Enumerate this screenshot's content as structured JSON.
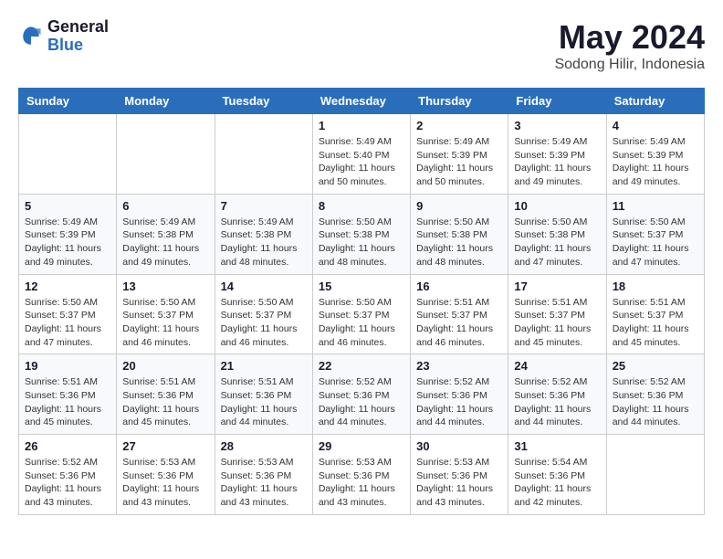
{
  "header": {
    "logo": {
      "general": "General",
      "blue": "Blue"
    },
    "title": "May 2024",
    "location": "Sodong Hilir, Indonesia"
  },
  "days_of_week": [
    "Sunday",
    "Monday",
    "Tuesday",
    "Wednesday",
    "Thursday",
    "Friday",
    "Saturday"
  ],
  "weeks": [
    [
      {
        "num": "",
        "sunrise": "",
        "sunset": "",
        "daylight": ""
      },
      {
        "num": "",
        "sunrise": "",
        "sunset": "",
        "daylight": ""
      },
      {
        "num": "",
        "sunrise": "",
        "sunset": "",
        "daylight": ""
      },
      {
        "num": "1",
        "sunrise": "Sunrise: 5:49 AM",
        "sunset": "Sunset: 5:40 PM",
        "daylight": "Daylight: 11 hours and 50 minutes."
      },
      {
        "num": "2",
        "sunrise": "Sunrise: 5:49 AM",
        "sunset": "Sunset: 5:39 PM",
        "daylight": "Daylight: 11 hours and 50 minutes."
      },
      {
        "num": "3",
        "sunrise": "Sunrise: 5:49 AM",
        "sunset": "Sunset: 5:39 PM",
        "daylight": "Daylight: 11 hours and 49 minutes."
      },
      {
        "num": "4",
        "sunrise": "Sunrise: 5:49 AM",
        "sunset": "Sunset: 5:39 PM",
        "daylight": "Daylight: 11 hours and 49 minutes."
      }
    ],
    [
      {
        "num": "5",
        "sunrise": "Sunrise: 5:49 AM",
        "sunset": "Sunset: 5:39 PM",
        "daylight": "Daylight: 11 hours and 49 minutes."
      },
      {
        "num": "6",
        "sunrise": "Sunrise: 5:49 AM",
        "sunset": "Sunset: 5:38 PM",
        "daylight": "Daylight: 11 hours and 49 minutes."
      },
      {
        "num": "7",
        "sunrise": "Sunrise: 5:49 AM",
        "sunset": "Sunset: 5:38 PM",
        "daylight": "Daylight: 11 hours and 48 minutes."
      },
      {
        "num": "8",
        "sunrise": "Sunrise: 5:50 AM",
        "sunset": "Sunset: 5:38 PM",
        "daylight": "Daylight: 11 hours and 48 minutes."
      },
      {
        "num": "9",
        "sunrise": "Sunrise: 5:50 AM",
        "sunset": "Sunset: 5:38 PM",
        "daylight": "Daylight: 11 hours and 48 minutes."
      },
      {
        "num": "10",
        "sunrise": "Sunrise: 5:50 AM",
        "sunset": "Sunset: 5:38 PM",
        "daylight": "Daylight: 11 hours and 47 minutes."
      },
      {
        "num": "11",
        "sunrise": "Sunrise: 5:50 AM",
        "sunset": "Sunset: 5:37 PM",
        "daylight": "Daylight: 11 hours and 47 minutes."
      }
    ],
    [
      {
        "num": "12",
        "sunrise": "Sunrise: 5:50 AM",
        "sunset": "Sunset: 5:37 PM",
        "daylight": "Daylight: 11 hours and 47 minutes."
      },
      {
        "num": "13",
        "sunrise": "Sunrise: 5:50 AM",
        "sunset": "Sunset: 5:37 PM",
        "daylight": "Daylight: 11 hours and 46 minutes."
      },
      {
        "num": "14",
        "sunrise": "Sunrise: 5:50 AM",
        "sunset": "Sunset: 5:37 PM",
        "daylight": "Daylight: 11 hours and 46 minutes."
      },
      {
        "num": "15",
        "sunrise": "Sunrise: 5:50 AM",
        "sunset": "Sunset: 5:37 PM",
        "daylight": "Daylight: 11 hours and 46 minutes."
      },
      {
        "num": "16",
        "sunrise": "Sunrise: 5:51 AM",
        "sunset": "Sunset: 5:37 PM",
        "daylight": "Daylight: 11 hours and 46 minutes."
      },
      {
        "num": "17",
        "sunrise": "Sunrise: 5:51 AM",
        "sunset": "Sunset: 5:37 PM",
        "daylight": "Daylight: 11 hours and 45 minutes."
      },
      {
        "num": "18",
        "sunrise": "Sunrise: 5:51 AM",
        "sunset": "Sunset: 5:37 PM",
        "daylight": "Daylight: 11 hours and 45 minutes."
      }
    ],
    [
      {
        "num": "19",
        "sunrise": "Sunrise: 5:51 AM",
        "sunset": "Sunset: 5:36 PM",
        "daylight": "Daylight: 11 hours and 45 minutes."
      },
      {
        "num": "20",
        "sunrise": "Sunrise: 5:51 AM",
        "sunset": "Sunset: 5:36 PM",
        "daylight": "Daylight: 11 hours and 45 minutes."
      },
      {
        "num": "21",
        "sunrise": "Sunrise: 5:51 AM",
        "sunset": "Sunset: 5:36 PM",
        "daylight": "Daylight: 11 hours and 44 minutes."
      },
      {
        "num": "22",
        "sunrise": "Sunrise: 5:52 AM",
        "sunset": "Sunset: 5:36 PM",
        "daylight": "Daylight: 11 hours and 44 minutes."
      },
      {
        "num": "23",
        "sunrise": "Sunrise: 5:52 AM",
        "sunset": "Sunset: 5:36 PM",
        "daylight": "Daylight: 11 hours and 44 minutes."
      },
      {
        "num": "24",
        "sunrise": "Sunrise: 5:52 AM",
        "sunset": "Sunset: 5:36 PM",
        "daylight": "Daylight: 11 hours and 44 minutes."
      },
      {
        "num": "25",
        "sunrise": "Sunrise: 5:52 AM",
        "sunset": "Sunset: 5:36 PM",
        "daylight": "Daylight: 11 hours and 44 minutes."
      }
    ],
    [
      {
        "num": "26",
        "sunrise": "Sunrise: 5:52 AM",
        "sunset": "Sunset: 5:36 PM",
        "daylight": "Daylight: 11 hours and 43 minutes."
      },
      {
        "num": "27",
        "sunrise": "Sunrise: 5:53 AM",
        "sunset": "Sunset: 5:36 PM",
        "daylight": "Daylight: 11 hours and 43 minutes."
      },
      {
        "num": "28",
        "sunrise": "Sunrise: 5:53 AM",
        "sunset": "Sunset: 5:36 PM",
        "daylight": "Daylight: 11 hours and 43 minutes."
      },
      {
        "num": "29",
        "sunrise": "Sunrise: 5:53 AM",
        "sunset": "Sunset: 5:36 PM",
        "daylight": "Daylight: 11 hours and 43 minutes."
      },
      {
        "num": "30",
        "sunrise": "Sunrise: 5:53 AM",
        "sunset": "Sunset: 5:36 PM",
        "daylight": "Daylight: 11 hours and 43 minutes."
      },
      {
        "num": "31",
        "sunrise": "Sunrise: 5:54 AM",
        "sunset": "Sunset: 5:36 PM",
        "daylight": "Daylight: 11 hours and 42 minutes."
      },
      {
        "num": "",
        "sunrise": "",
        "sunset": "",
        "daylight": ""
      }
    ]
  ]
}
